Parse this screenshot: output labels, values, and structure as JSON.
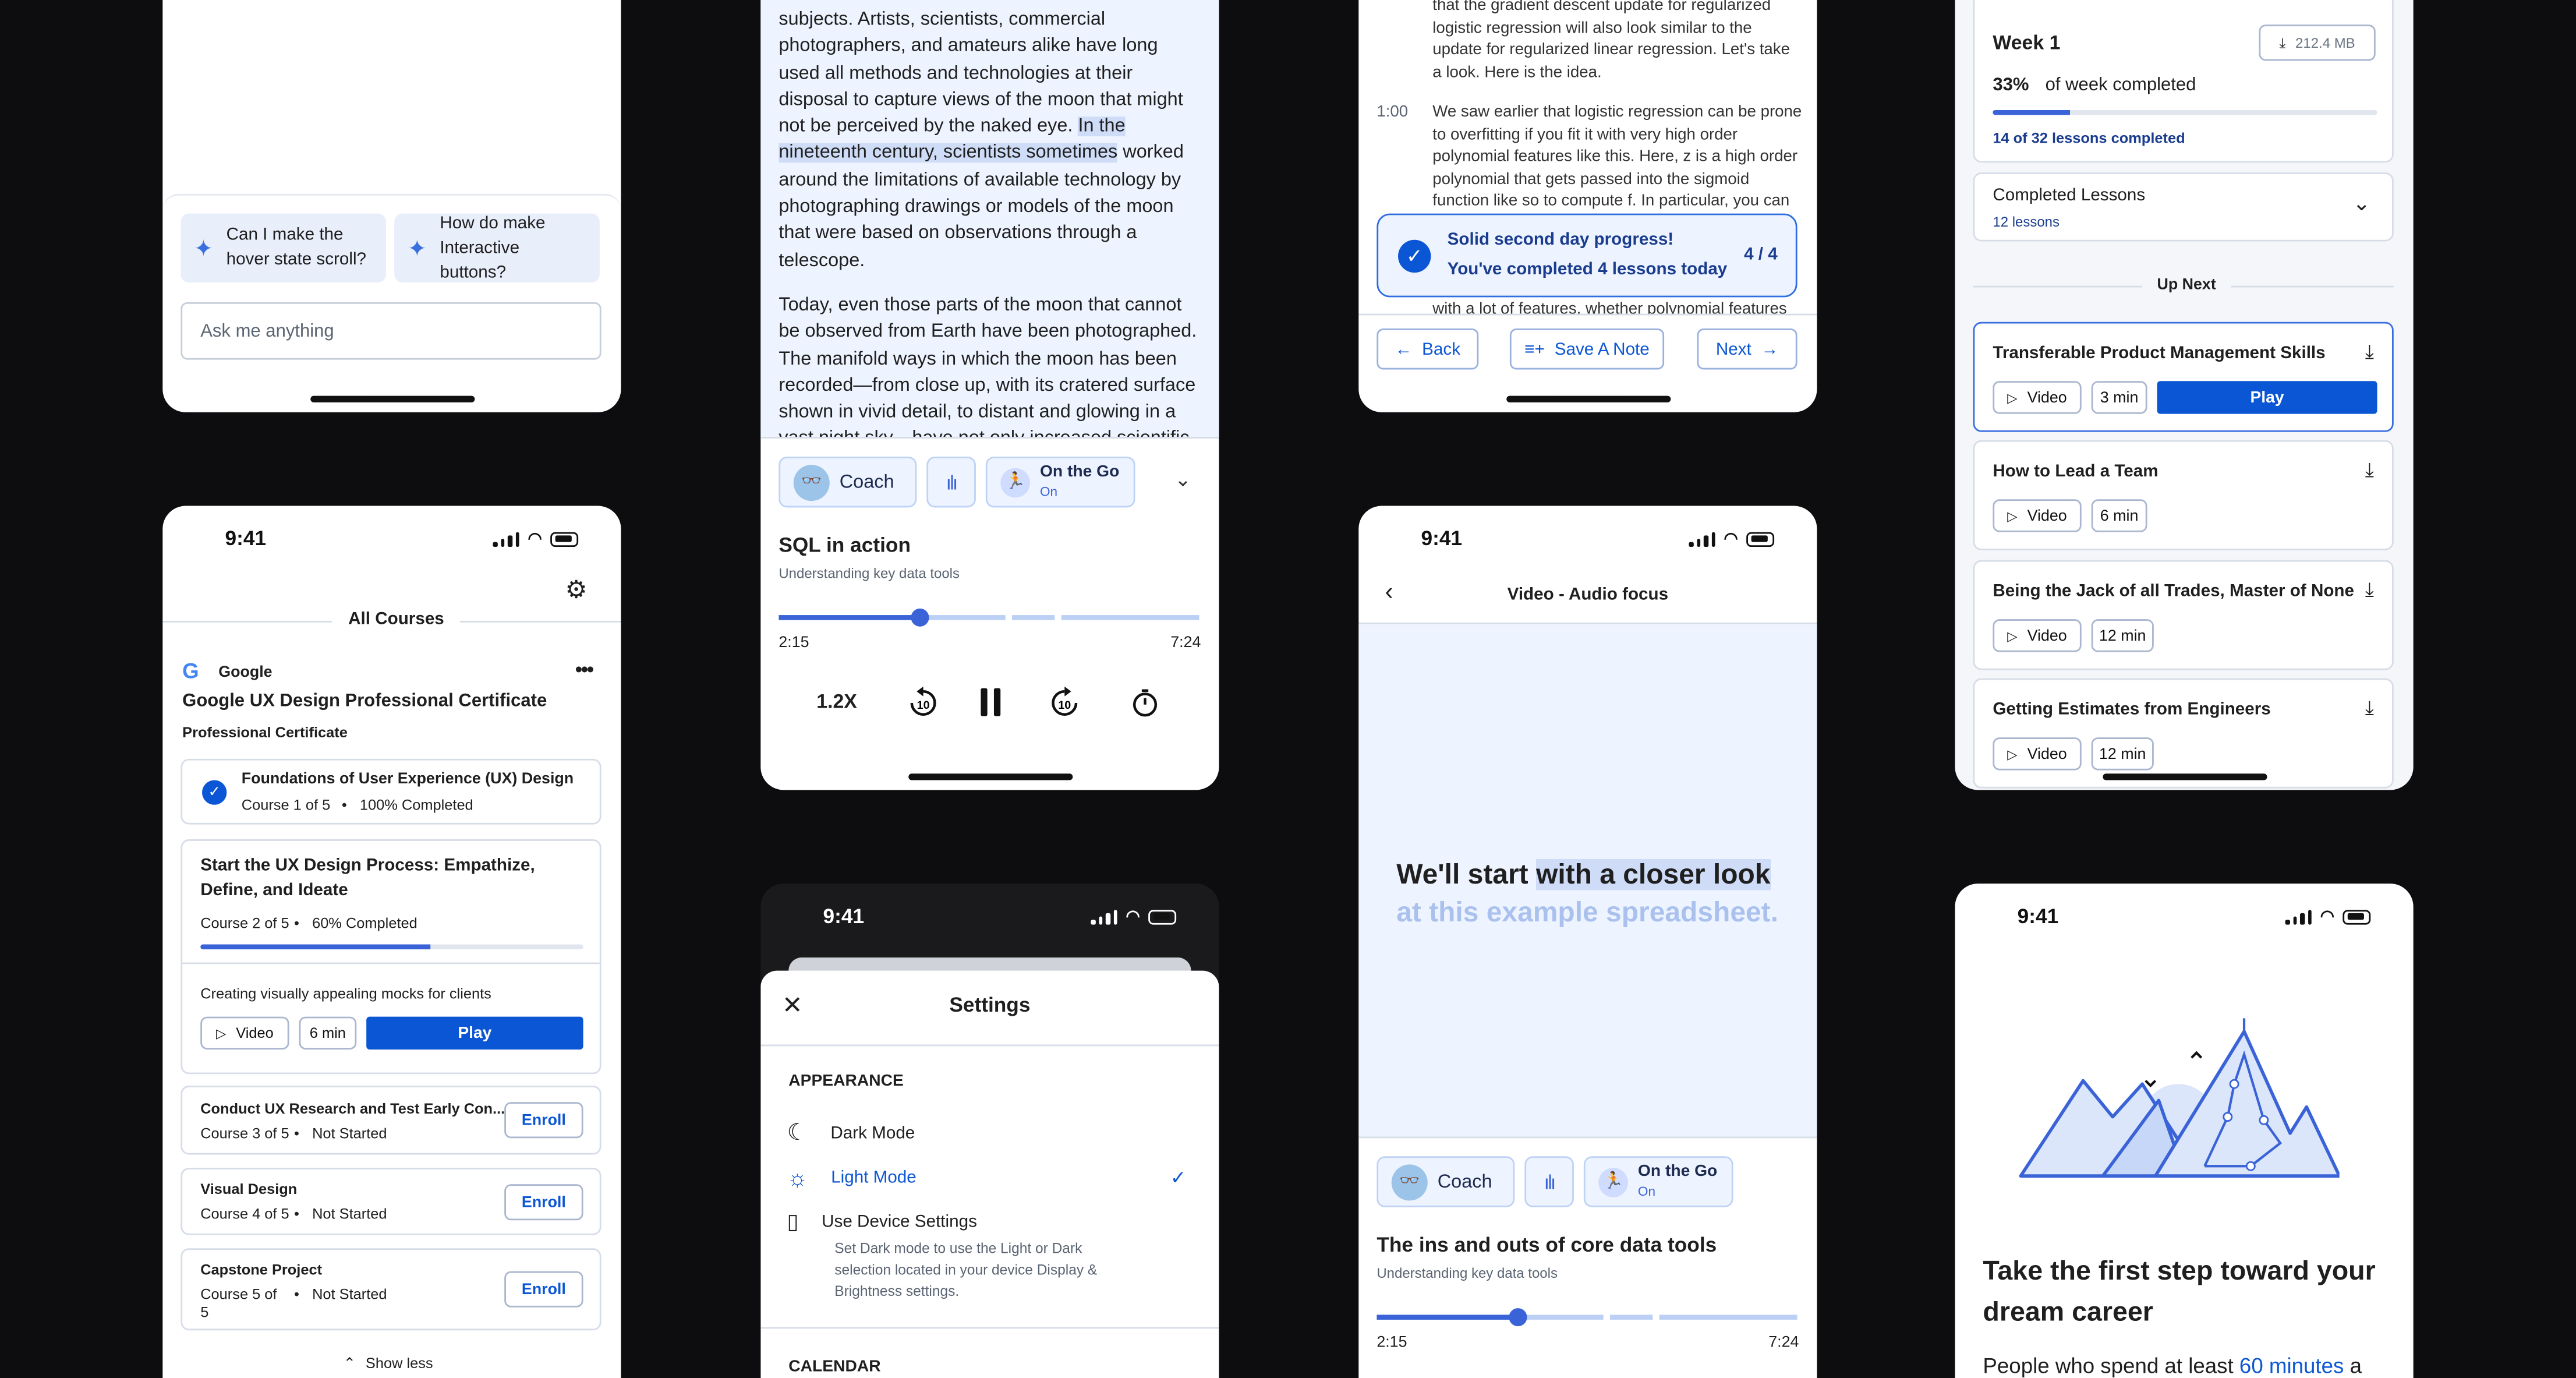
{
  "card1": {
    "suggestions": [
      "Can I make the hover state scroll?",
      "How do make Interactive buttons?"
    ],
    "ask_placeholder": "Ask me anything"
  },
  "card2": {
    "para1_pre": "subjects. Artists, scientists, commercial photographers, and amateurs alike have long used all methods and technologies at their disposal to capture views of the moon that might not be perceived by the naked eye.",
    "para1_hl": "In the nineteenth century, scientists sometimes",
    "para1_post": "worked around the limitations of available technology by photographing drawings or models of the moon that were based on observations through a telescope.",
    "para2": "Today, even those parts of the moon that cannot be observed from Earth have been photographed. The manifold ways in which the moon has been recorded—from close up, with its cratered surface shown in vivid detail, to distant and glowing in a vast night sky—have not only increased scientific knowledge of our",
    "coach": "Coach",
    "onthego": "On the Go",
    "onthego_state": "On",
    "track_title": "SQL in action",
    "track_sub": "Understanding key data tools",
    "elapsed": "2:15",
    "total": "7:24",
    "progress": 0.35,
    "speed": "1.2X",
    "skip": "10"
  },
  "card3": {
    "transcript_top": "that the gradient descent update for regularized logistic regression will also look similar to the update for regularized linear regression. Let's take a look. Here is the idea.",
    "time": "1:00",
    "transcript_body": "We saw earlier that logistic regression can be prone to overfitting if you fit it with very high order polynomial features like this. Here, z is a high order polynomial that gets passed into the sigmoid function like so to compute f. In particular, you can",
    "transcript_tail": "with a lot of features, whether polynomial features",
    "toast_title": "Solid second day progress!",
    "toast_sub": "You've completed 4 lessons today",
    "toast_count": "4 / 4",
    "back": "Back",
    "save_note": "Save A Note",
    "next": "Next"
  },
  "card4": {
    "week": "Week 1",
    "size": "212.4 MB",
    "pct": "33%",
    "pct_label": "of week completed",
    "week_progress": 0.2,
    "lessons_completed": "14 of 32 lessons completed",
    "completed_title": "Completed Lessons",
    "completed_count": "12 lessons",
    "up_next": "Up Next",
    "items": [
      {
        "title": "Transferable Product Management Skills",
        "type": "Video",
        "dur": "3 min",
        "play": "Play"
      },
      {
        "title": "How to Lead a Team",
        "type": "Video",
        "dur": "6 min"
      },
      {
        "title": "Being the Jack of all Trades, Master of None",
        "type": "Video",
        "dur": "12 min"
      },
      {
        "title": "Getting Estimates from Engineers",
        "type": "Video",
        "dur": "12 min"
      }
    ]
  },
  "card5": {
    "time": "9:41",
    "header": "All Courses",
    "provider": "Google",
    "program": "Google UX Design Professional Certificate",
    "program_type": "Professional Certificate",
    "c1_title": "Foundations of User Experience (UX) Design",
    "c1_meta": "Course 1 of 5",
    "c1_status": "100% Completed",
    "c2_title": "Start the UX Design Process: Empathize, Define, and Ideate",
    "c2_meta": "Course 2 of 5",
    "c2_status": "60% Completed",
    "c2_progress": 0.6,
    "c2_lesson": "Creating visually appealing mocks for clients",
    "c2_type": "Video",
    "c2_dur": "6 min",
    "c2_play": "Play",
    "others": [
      {
        "title": "Conduct UX Research and Test Early Con...",
        "meta": "Course 3 of 5",
        "status": "Not Started",
        "btn": "Enroll"
      },
      {
        "title": "Visual Design",
        "meta": "Course 4 of 5",
        "status": "Not Started",
        "btn": "Enroll"
      },
      {
        "title": "Capstone Project",
        "meta": "Course 5 of 5",
        "status": "Not Started",
        "btn": "Enroll"
      }
    ],
    "show_less": "Show less"
  },
  "card6": {
    "time": "9:41",
    "title": "Settings",
    "appearance": "APPEARANCE",
    "dark": "Dark Mode",
    "light": "Light Mode",
    "device": "Use Device Settings",
    "device_desc": "Set Dark mode to use the Light or Dark selection located in your device Display & Brightness settings.",
    "calendar": "CALENDAR"
  },
  "card7": {
    "time": "9:41",
    "title": "Video - Audio focus",
    "l1_a": "We'll start",
    "l1_b": "with a closer look",
    "l2": "at this example spreadsheet.",
    "coach": "Coach",
    "onthego": "On the Go",
    "onthego_state": "On",
    "track_title": "The ins and outs of core data tools",
    "track_sub": "Understanding key data tools",
    "elapsed": "2:15",
    "total": "7:24",
    "progress": 0.35
  },
  "card8": {
    "time": "9:41",
    "headline": "Take the first step toward your dream career",
    "body_pre": "People who spend at least",
    "body_hl": "60 minutes",
    "body_post": "a"
  },
  "colors": {
    "primary": "#0b56d4",
    "tint": "#eef4ff",
    "background": "#0d0d0f"
  }
}
